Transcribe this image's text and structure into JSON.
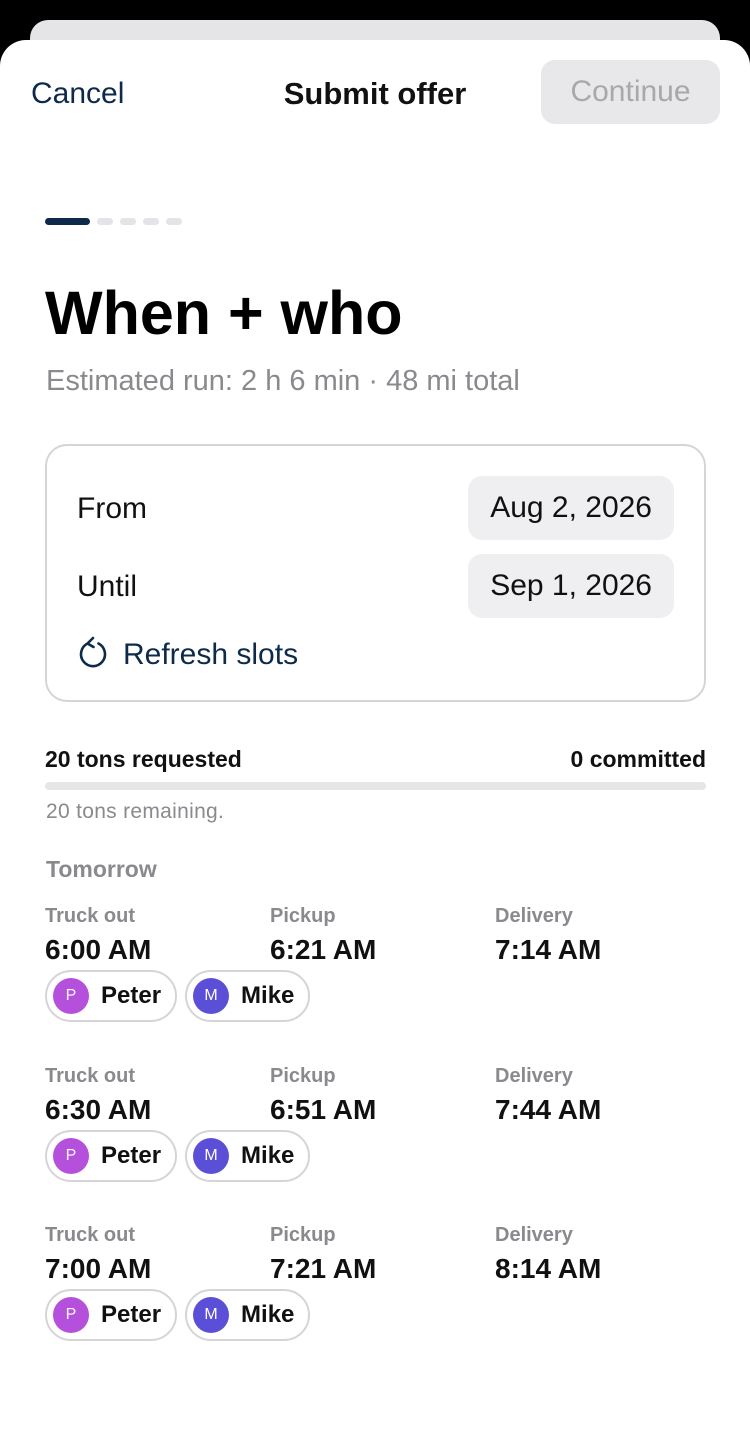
{
  "nav": {
    "cancel": "Cancel",
    "title": "Submit offer",
    "continue": "Continue"
  },
  "steps": {
    "total": 5,
    "current": 1
  },
  "page": {
    "title": "When + who",
    "subtitle": "Estimated run: 2 h 6 min · 48 mi total"
  },
  "range": {
    "from_label": "From",
    "from_value": "Aug 2, 2026",
    "until_label": "Until",
    "until_value": "Sep 1, 2026",
    "refresh_label": "Refresh slots",
    "refresh_icon": "refresh-icon"
  },
  "tons": {
    "requested": "20 tons requested",
    "committed": "0 committed",
    "remaining": "20 tons remaining.",
    "progress": 0
  },
  "day_label": "Tomorrow",
  "slot_labels": {
    "truck_out": "Truck out",
    "pickup": "Pickup",
    "delivery": "Delivery"
  },
  "slots": [
    {
      "truck_out": "6:00 AM",
      "pickup": "6:21 AM",
      "delivery": "7:14 AM",
      "drivers": [
        {
          "initial": "P",
          "name": "Peter",
          "color": "#b450dc"
        },
        {
          "initial": "M",
          "name": "Mike",
          "color": "#5a4fd6"
        }
      ]
    },
    {
      "truck_out": "6:30 AM",
      "pickup": "6:51 AM",
      "delivery": "7:44 AM",
      "drivers": [
        {
          "initial": "P",
          "name": "Peter",
          "color": "#b450dc"
        },
        {
          "initial": "M",
          "name": "Mike",
          "color": "#5a4fd6"
        }
      ]
    },
    {
      "truck_out": "7:00 AM",
      "pickup": "7:21 AM",
      "delivery": "8:14 AM",
      "drivers": [
        {
          "initial": "P",
          "name": "Peter",
          "color": "#b450dc"
        },
        {
          "initial": "M",
          "name": "Mike",
          "color": "#5a4fd6"
        }
      ]
    }
  ],
  "colors": {
    "accent": "#0e2a4a",
    "muted": "#8a8a8e"
  }
}
